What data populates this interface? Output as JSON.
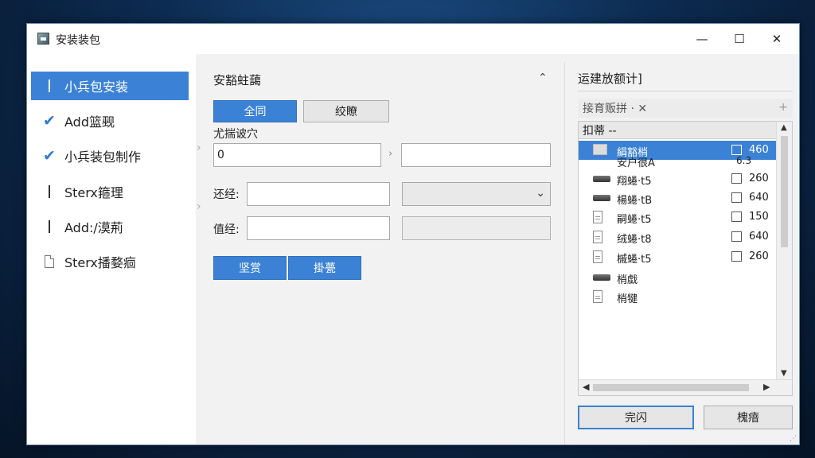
{
  "window": {
    "title": "安装装包",
    "controls": {
      "minimize": "—",
      "maximize": "☐",
      "close": "✕"
    }
  },
  "sidebar": {
    "items": [
      {
        "label": "小兵包安装",
        "icon": "bar-icon",
        "active": true
      },
      {
        "label": "Add篮觋",
        "icon": "check-icon"
      },
      {
        "label": "小兵装包制作",
        "icon": "check-icon"
      },
      {
        "label": "Sterx箍理",
        "icon": "bar-icon"
      },
      {
        "label": "Add:/漠荊",
        "icon": "bar-icon"
      },
      {
        "label": "Sterx播婺痐",
        "icon": "document-icon"
      }
    ]
  },
  "main": {
    "section_title": "安豁蛀藹",
    "primary_tab": "全同",
    "secondary_tab": "绞瞭",
    "source_label": "尤揣诐穴",
    "source_value": "0",
    "path_label": "还经:",
    "value_label": "值经:",
    "action_primary": "坚赏",
    "action_secondary": "掛甍"
  },
  "right_panel": {
    "title": "运建放额计]",
    "search_placeholder": "接育贩拼 ·  ✕",
    "list_header": "扣蒂 --",
    "sub_label": "安户很A",
    "sub_size": "6.3",
    "rows": [
      {
        "name": "絹豁梢",
        "icon": "folder-icon",
        "size": "460",
        "selected": true
      },
      {
        "name": "翔蜷·t5",
        "icon": "drive-icon",
        "size": "260"
      },
      {
        "name": "楊蜷·tB",
        "icon": "drive-icon",
        "size": "640"
      },
      {
        "name": "嗣蜷·t5",
        "icon": "file-icon",
        "size": "150"
      },
      {
        "name": "绒蜷·t8",
        "icon": "file-icon",
        "size": "640"
      },
      {
        "name": "槭蜷·t5",
        "icon": "file-icon",
        "size": "260"
      },
      {
        "name": "梢戱",
        "icon": "drive-icon",
        "size": ""
      },
      {
        "name": "梢犍",
        "icon": "file-icon",
        "size": ""
      }
    ],
    "ok_button": "完闪",
    "cancel_button": "槐瘖"
  },
  "colors": {
    "accent": "#3b82d6",
    "window_bg": "#f2f2f2"
  }
}
